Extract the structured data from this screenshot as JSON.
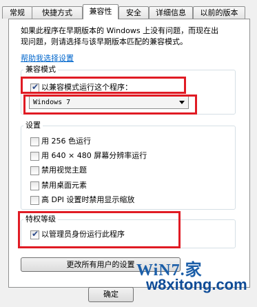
{
  "tabs": [
    {
      "label": "常规"
    },
    {
      "label": "快捷方式"
    },
    {
      "label": "兼容性"
    },
    {
      "label": "安全"
    },
    {
      "label": "详细信息"
    },
    {
      "label": "以前的版本"
    }
  ],
  "intro": {
    "line1": "如果此程序在早期版本的 Windows 上没有问题，而现在出",
    "line2": "现问题，则请选择与该早期版本匹配的兼容模式。",
    "help_link": "帮助我选择设置"
  },
  "compat_mode": {
    "title": "兼容模式",
    "checkbox_label": "以兼容模式运行这个程序：",
    "checked": true,
    "selected_os": "Windows 7"
  },
  "settings": {
    "title": "设置",
    "options": [
      {
        "label": "用 256 色运行",
        "checked": false
      },
      {
        "label": "用 640 × 480 屏幕分辨率运行",
        "checked": false
      },
      {
        "label": "禁用视觉主题",
        "checked": false
      },
      {
        "label": "禁用桌面元素",
        "checked": false
      },
      {
        "label": "高 DPI 设置时禁用显示缩放",
        "checked": false
      }
    ]
  },
  "privilege": {
    "title": "特权等级",
    "checkbox_label": "以管理员身份运行此程序",
    "checked": true
  },
  "buttons": {
    "all_users": "更改所有用户的设置",
    "ok": "确定"
  },
  "watermark": {
    "logo": "WiN7.家",
    "url": "w8xitong.com"
  },
  "colors": {
    "highlight_box": "#e01b24",
    "link": "#0066cc"
  }
}
